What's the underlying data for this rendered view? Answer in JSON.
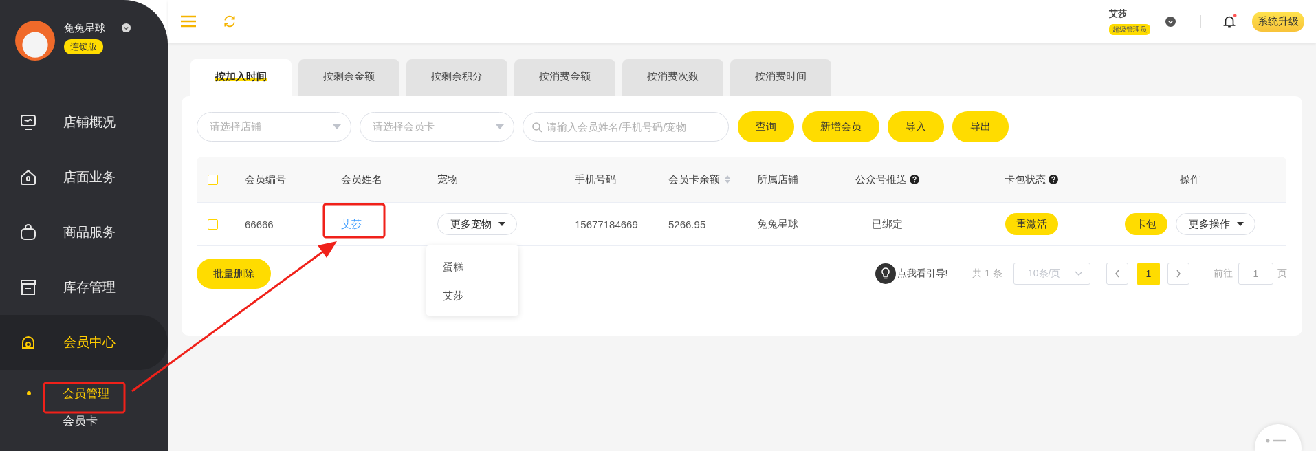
{
  "sidebar": {
    "store_name": "兔兔星球",
    "edition_badge": "连锁版",
    "items": [
      {
        "label": "店铺概况",
        "kind": "monitor",
        "selected": false
      },
      {
        "label": "店面业务",
        "kind": "house",
        "selected": false
      },
      {
        "label": "商品服务",
        "kind": "bag",
        "selected": false
      },
      {
        "label": "库存管理",
        "kind": "box",
        "selected": false
      },
      {
        "label": "会员中心",
        "kind": "member",
        "selected": true,
        "children": [
          {
            "label": "会员管理",
            "selected": true
          },
          {
            "label": "会员卡",
            "selected": false
          }
        ]
      }
    ]
  },
  "header": {
    "user_name": "艾莎",
    "role_badge": "超级管理员",
    "has_notification": true,
    "upgrade_button": "系统升级"
  },
  "tabs": [
    {
      "label": "按加入时间",
      "selected": true
    },
    {
      "label": "按剩余金额",
      "selected": false
    },
    {
      "label": "按剩余积分",
      "selected": false
    },
    {
      "label": "按消费金额",
      "selected": false
    },
    {
      "label": "按消费次数",
      "selected": false
    },
    {
      "label": "按消费时间",
      "selected": false
    }
  ],
  "filters": {
    "store_select": {
      "placeholder": "请选择店铺"
    },
    "card_select": {
      "placeholder": "请选择会员卡"
    },
    "search": {
      "placeholder": "请输入会员姓名/手机号码/宠物"
    }
  },
  "buttons": [
    "查询",
    "新增会员",
    "导入",
    "导出"
  ],
  "table": {
    "select_all_checked": false,
    "columns": [
      {
        "label": "会员编号"
      },
      {
        "label": "会员姓名"
      },
      {
        "label": "宠物"
      },
      {
        "label": "手机号码"
      },
      {
        "label": "会员卡余额",
        "sortable": true
      },
      {
        "label": "所属店铺"
      },
      {
        "label": "公众号推送",
        "help": true
      },
      {
        "label": "卡包状态",
        "help": true
      },
      {
        "label": "操作"
      }
    ],
    "rows": [
      {
        "checked": false,
        "member_no": "66666",
        "name": "艾莎",
        "pets_button": "更多宠物",
        "phone": "15677184669",
        "balance": "5266.95",
        "store": "兔兔星球",
        "wechat_push": "已绑定",
        "card_status_button": "重激活",
        "card_button": "卡包",
        "more_button": "更多操作"
      }
    ]
  },
  "pet_dropdown": {
    "items": [
      "蛋糕",
      "艾莎"
    ]
  },
  "batch_delete": "批量删除",
  "pagination": {
    "guide": "点我看引导!",
    "total": "共 1 条",
    "page_size": "10条/页",
    "pages": [
      {
        "label": "1",
        "selected": true
      }
    ],
    "goto_label": "前往",
    "goto_value": "1",
    "page_unit": "页"
  }
}
